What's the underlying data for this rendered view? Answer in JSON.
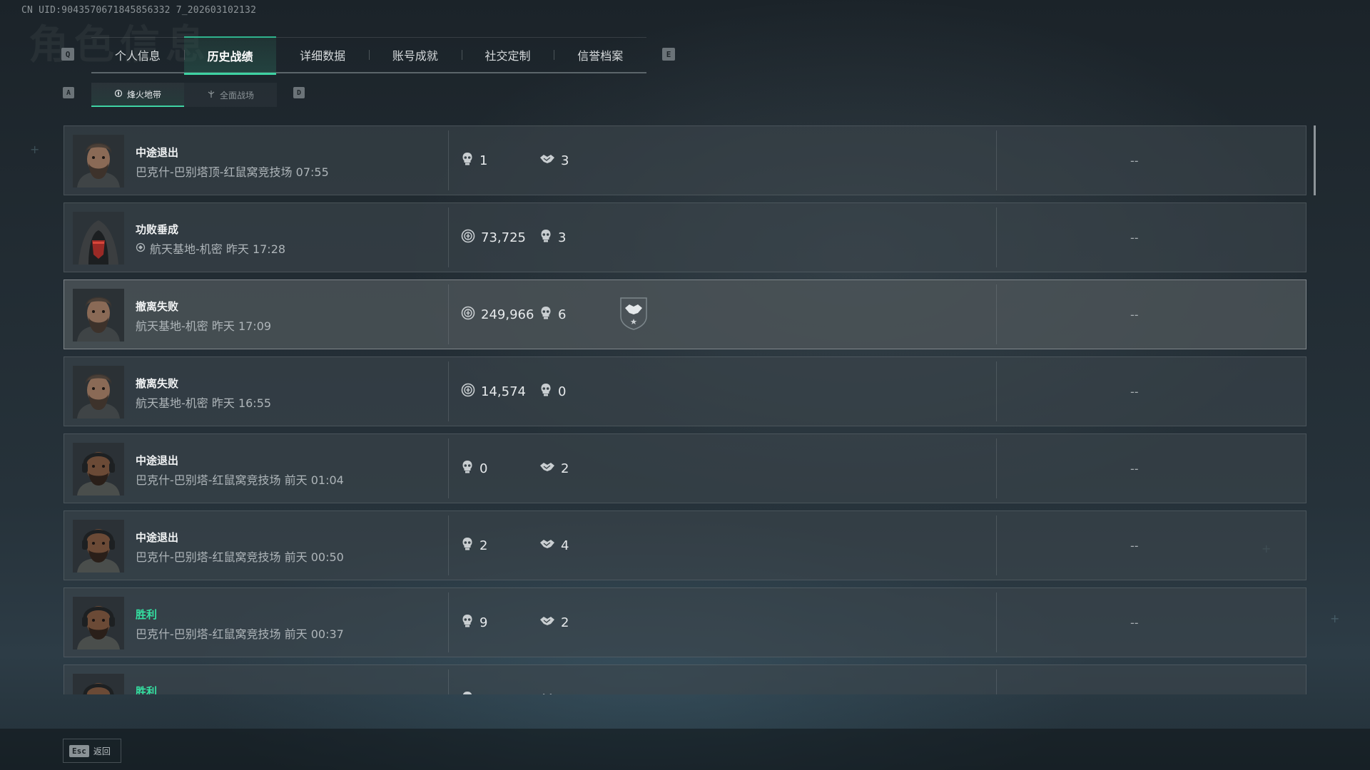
{
  "uid": "CN UID:9043570671845856332 7_202603102132",
  "ghost_title": "角色信息",
  "keys": {
    "prev_tab": "Q",
    "next_tab": "E",
    "prev_sub": "A",
    "next_sub": "D"
  },
  "tabs": [
    {
      "label": "个人信息",
      "active": false
    },
    {
      "label": "历史战绩",
      "active": true
    },
    {
      "label": "详细数据",
      "active": false
    },
    {
      "label": "账号成就",
      "active": false
    },
    {
      "label": "社交定制",
      "active": false
    },
    {
      "label": "信誉档案",
      "active": false
    }
  ],
  "subtabs": [
    {
      "label": "烽火地带",
      "icon": "compass-icon",
      "active": true
    },
    {
      "label": "全面战场",
      "icon": "battlefield-icon",
      "active": false
    }
  ],
  "rows": [
    {
      "outcome": "中途退出",
      "outcome_color": "#f1f3f4",
      "detail": "巴克什-巴别塔顶-红鼠窝竞技场 07:55",
      "has_mode_icon": false,
      "stat1_icon": "kill-icon",
      "stat1": "1",
      "stat2_icon": "assist-icon",
      "stat2": "3",
      "medal": false,
      "avatar": "male-bearded",
      "result": "--"
    },
    {
      "outcome": "功败垂成",
      "outcome_color": "#f1f3f4",
      "detail": "航天基地-机密 昨天 17:28",
      "has_mode_icon": true,
      "stat1_icon": "value-icon",
      "stat1": "73,725",
      "stat2_icon": "kill-icon",
      "stat2": "3",
      "medal": false,
      "avatar": "hooded-red",
      "result": "--"
    },
    {
      "outcome": "撤离失败",
      "outcome_color": "#f1f3f4",
      "detail": "航天基地-机密 昨天 17:09",
      "has_mode_icon": false,
      "stat1_icon": "value-icon",
      "stat1": "249,966",
      "stat2_icon": "kill-icon",
      "stat2": "6",
      "medal": true,
      "avatar": "male-bearded",
      "result": "--",
      "highlight": true
    },
    {
      "outcome": "撤离失败",
      "outcome_color": "#f1f3f4",
      "detail": "航天基地-机密 昨天 16:55",
      "has_mode_icon": false,
      "stat1_icon": "value-icon",
      "stat1": "14,574",
      "stat2_icon": "kill-icon",
      "stat2": "0",
      "medal": false,
      "avatar": "male-bearded",
      "result": "--"
    },
    {
      "outcome": "中途退出",
      "outcome_color": "#f1f3f4",
      "detail": "巴克什-巴别塔-红鼠窝竞技场 前天 01:04",
      "has_mode_icon": false,
      "stat1_icon": "kill-icon",
      "stat1": "0",
      "stat2_icon": "assist-icon",
      "stat2": "2",
      "medal": false,
      "avatar": "male-headset",
      "result": "--"
    },
    {
      "outcome": "中途退出",
      "outcome_color": "#f1f3f4",
      "detail": "巴克什-巴别塔-红鼠窝竞技场 前天 00:50",
      "has_mode_icon": false,
      "stat1_icon": "kill-icon",
      "stat1": "2",
      "stat2_icon": "assist-icon",
      "stat2": "4",
      "medal": false,
      "avatar": "male-headset",
      "result": "--"
    },
    {
      "outcome": "胜利",
      "outcome_color": "#34e0a1",
      "detail": "巴克什-巴别塔-红鼠窝竞技场 前天 00:37",
      "has_mode_icon": false,
      "stat1_icon": "kill-icon",
      "stat1": "9",
      "stat2_icon": "assist-icon",
      "stat2": "2",
      "medal": false,
      "avatar": "male-headset",
      "result": "--"
    },
    {
      "outcome": "胜利",
      "outcome_color": "#34e0a1",
      "detail": "",
      "has_mode_icon": false,
      "stat1_icon": "kill-icon",
      "stat1": "",
      "stat2_icon": "assist-icon",
      "stat2": "",
      "medal": false,
      "avatar": "male-headset",
      "result": ""
    }
  ],
  "footer": {
    "esc_key": "Esc",
    "back_label": "返回"
  },
  "colors": {
    "accent": "#3fd3a3",
    "win": "#34e0a1"
  }
}
